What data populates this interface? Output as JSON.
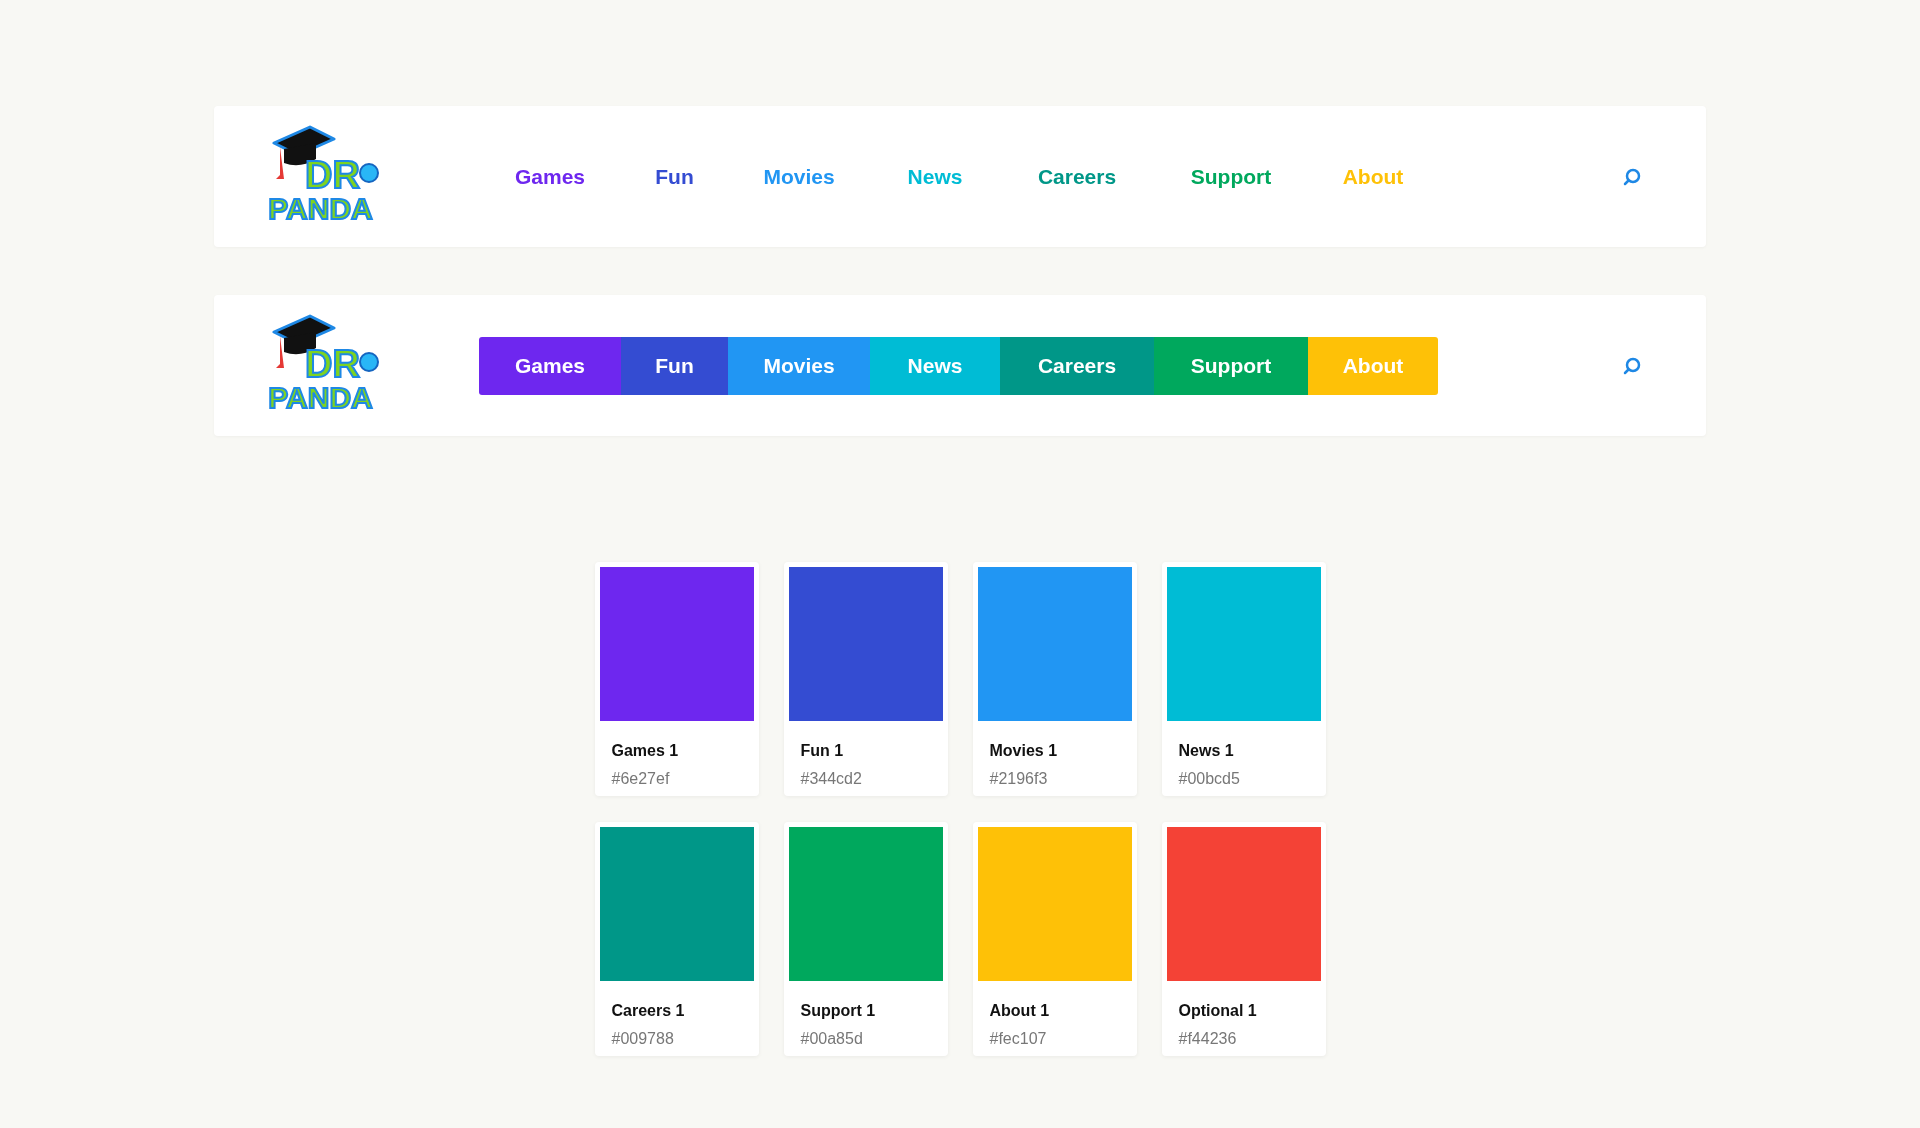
{
  "navbars": [
    {
      "kind": "text",
      "logo": {
        "line_1": "DR",
        "line_2": "PANDA"
      },
      "items": [
        {
          "label": "Games",
          "color": "#6e27ef"
        },
        {
          "label": "Fun",
          "color": "#344cd2"
        },
        {
          "label": "Movies",
          "color": "#2196f3"
        },
        {
          "label": "News",
          "color": "#00bcd5"
        },
        {
          "label": "Careers",
          "color": "#009788"
        },
        {
          "label": "Support",
          "color": "#00a85d"
        },
        {
          "label": "About",
          "color": "#fec107"
        }
      ]
    },
    {
      "kind": "filled",
      "logo": {
        "line_1": "DR",
        "line_2": "PANDA"
      },
      "items": [
        {
          "label": "Games",
          "color": "#6e27ef"
        },
        {
          "label": "Fun",
          "color": "#344cd2"
        },
        {
          "label": "Movies",
          "color": "#2196f3"
        },
        {
          "label": "News",
          "color": "#00bcd5"
        },
        {
          "label": "Careers",
          "color": "#009788"
        },
        {
          "label": "Support",
          "color": "#00a85d"
        },
        {
          "label": "About",
          "color": "#fec107"
        }
      ]
    }
  ],
  "swatches": [
    {
      "name": "Games 1",
      "hex": "#6e27ef",
      "color": "#6e27ef"
    },
    {
      "name": "Fun 1",
      "hex": "#344cd2",
      "color": "#344cd2"
    },
    {
      "name": "Movies 1",
      "hex": "#2196f3",
      "color": "#2196f3"
    },
    {
      "name": "News 1",
      "hex": "#00bcd5",
      "color": "#00bcd5"
    },
    {
      "name": "Careers 1",
      "hex": "#009788",
      "color": "#009788"
    },
    {
      "name": "Support 1",
      "hex": "#00a85d",
      "color": "#00a85d"
    },
    {
      "name": "About 1",
      "hex": "#fec107",
      "color": "#fec107"
    },
    {
      "name": "Optional 1",
      "hex": "#f44236",
      "color": "#f44236"
    }
  ]
}
